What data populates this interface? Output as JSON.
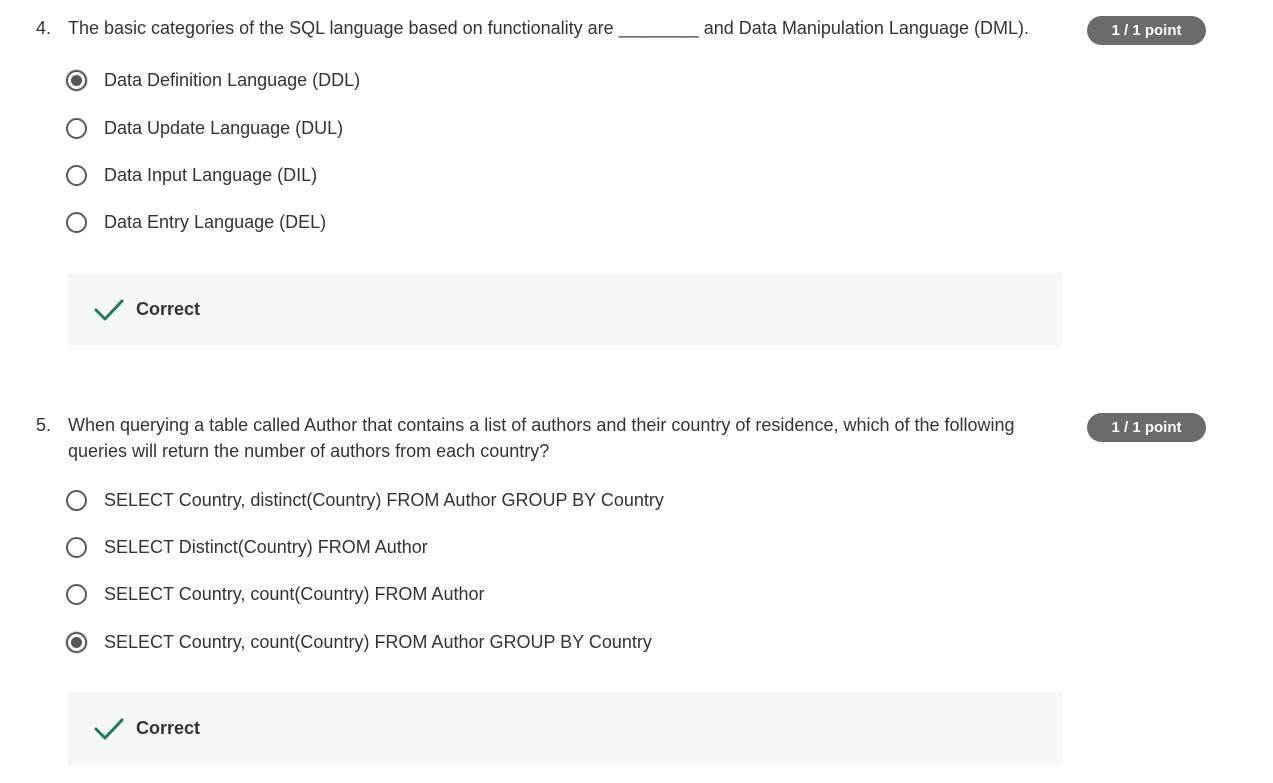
{
  "questions": [
    {
      "number": "4.",
      "prompt": "The basic categories of the SQL language based on functionality are ________ and Data Manipulation Language (DML).",
      "points": "1 / 1 point",
      "options": [
        {
          "label": "Data Definition Language (DDL)",
          "selected": true
        },
        {
          "label": "Data Update Language (DUL)",
          "selected": false
        },
        {
          "label": "Data Input Language (DIL)",
          "selected": false
        },
        {
          "label": "Data Entry Language (DEL)",
          "selected": false
        }
      ],
      "feedback": {
        "label": "Correct",
        "icon": "check-icon"
      }
    },
    {
      "number": "5.",
      "prompt": "When querying a table called Author that contains a list of authors and their country of residence, which of the following queries will return the number of authors from each country?",
      "points": "1 / 1 point",
      "options": [
        {
          "label": "SELECT Country, distinct(Country) FROM Author GROUP BY Country",
          "selected": false
        },
        {
          "label": "SELECT Distinct(Country) FROM Author",
          "selected": false
        },
        {
          "label": "SELECT Country, count(Country) FROM Author",
          "selected": false
        },
        {
          "label": "SELECT Country, count(Country) FROM Author GROUP BY Country",
          "selected": true
        }
      ],
      "feedback": {
        "label": "Correct",
        "icon": "check-icon"
      }
    }
  ],
  "colors": {
    "badge_bg": "#6b6b6b",
    "feedback_bg": "#f5f8f7",
    "check_green": "#1f7a55",
    "text": "#333333"
  }
}
